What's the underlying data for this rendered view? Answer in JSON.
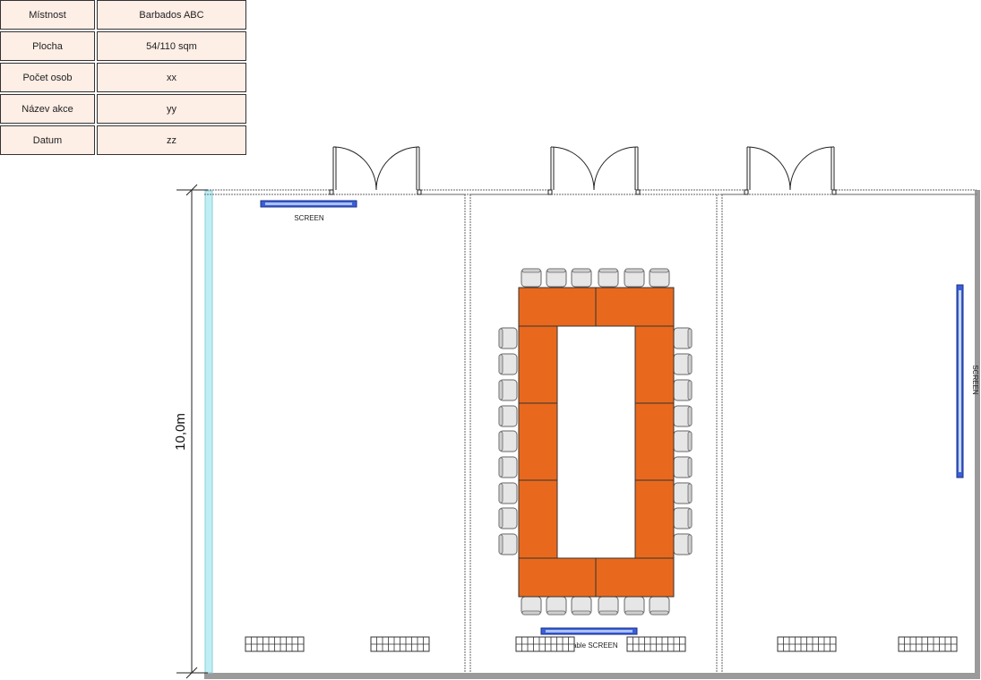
{
  "info_table": {
    "rows": [
      {
        "label": "Místnost",
        "value": "Barbados ABC"
      },
      {
        "label": "Plocha",
        "value": "54/110 sqm"
      },
      {
        "label": "Počet osob",
        "value": "xx"
      },
      {
        "label": "Název akce",
        "value": "yy"
      },
      {
        "label": "Datum",
        "value": "zz"
      }
    ]
  },
  "plan": {
    "dimension_label": "10,0m",
    "screen_labels": {
      "left_room": "SCREEN",
      "right_room": "SCREEN",
      "middle_room": "Portable SCREEN"
    },
    "colors": {
      "table": "#e8691e",
      "screen": "#3a5fd8",
      "chair": "#e6e6e6",
      "window_wall": "#bfeff5",
      "wall": "#9a9a9a"
    }
  }
}
